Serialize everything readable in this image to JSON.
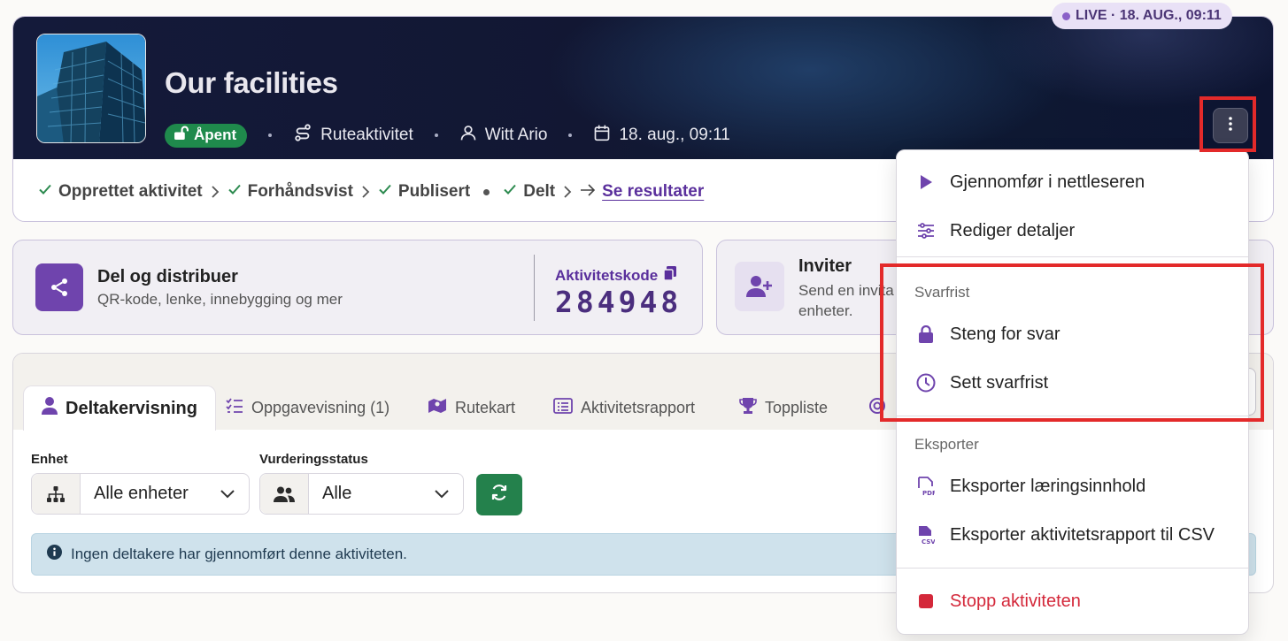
{
  "header": {
    "title": "Our facilities",
    "live_label": "LIVE · 18. AUG., 09:11",
    "status_badge": "Åpent",
    "activity_type": "Ruteaktivitet",
    "owner": "Witt Ario",
    "date": "18. aug., 09:11"
  },
  "steps": {
    "created": "Opprettet aktivitet",
    "previewed": "Forhåndsvist",
    "published": "Publisert",
    "shared": "Delt",
    "results_link": "Se resultater"
  },
  "share_card": {
    "title": "Del og distribuer",
    "subtitle": "QR-kode, lenke, innebygging og mer",
    "code_label": "Aktivitetskode",
    "code_value": "284948"
  },
  "invite_card": {
    "title": "Inviter",
    "subtitle_line1": "Send en invita",
    "subtitle_line2": "enheter."
  },
  "tabs": [
    {
      "label": "Deltakervisning",
      "icon": "user-icon"
    },
    {
      "label": "Oppgavevisning (1)",
      "icon": "task-list-icon"
    },
    {
      "label": "Rutekart",
      "icon": "map-icon"
    },
    {
      "label": "Aktivitetsrapport",
      "icon": "report-icon"
    },
    {
      "label": "Toppliste",
      "icon": "trophy-icon"
    }
  ],
  "filters": {
    "unit_label": "Enhet",
    "unit_value": "Alle enheter",
    "status_label": "Vurderingsstatus",
    "status_value": "Alle"
  },
  "alert": {
    "text": "Ingen deltakere har gjennomført denne aktiviteten."
  },
  "menu": {
    "run_in_browser": "Gjennomfør i nettleseren",
    "edit_details": "Rediger detaljer",
    "deadline_header": "Svarfrist",
    "close_answers": "Steng for svar",
    "set_deadline": "Sett svarfrist",
    "export_header": "Eksporter",
    "export_learning": "Eksporter læringsinnhold",
    "export_csv": "Eksporter aktivitetsrapport til CSV",
    "stop_activity": "Stopp aktiviteten"
  },
  "colors": {
    "accent": "#6f44ad",
    "success": "#1f8a4c",
    "danger": "#d4283a",
    "highlight": "#e32a2a"
  }
}
